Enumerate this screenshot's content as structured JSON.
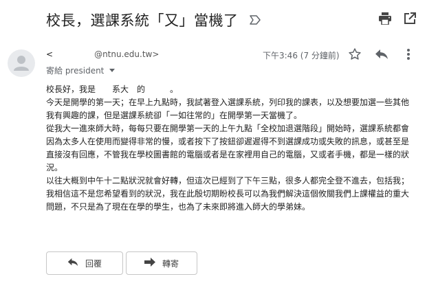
{
  "message": {
    "subject": "校長，選課系統「又」當機了",
    "sender": {
      "name": "<",
      "email": "@ntnu.edu.tw>"
    },
    "recipient_line": "寄給 president",
    "timestamp": "下午3:46 (7 分鐘前)",
    "body": [
      "校長好，我是　　系大　的　　　。",
      "今天是開學的第一天；在早上九點時，我試著登入選課系統，列印我的課表，以及想要加選一些其他我有興趣的課，但是選課系統卻「一如往常的」在開學第一天當機了。",
      "從我大一進來師大時，每每只要在開學第一天的上午九點「全校加退選階段」開始時，選課系統都會因為太多人在使用而變得非常的慢，或者按下了按鈕卻遲遲得不到選課成功或失敗的訊息，或甚至是直接沒有回應，不管我在學校圖書館的電腦或者是在家裡用自己的電腦，又或者手機，都是一樣的狀況。",
      "以往大概到中午十二點狀況就會好轉，但這次已經到了下午三點，很多人都完全登不進去，包括我；我相信這不是您希望看到的狀況，我在此殷切期盼校長可以為我們解決這個攸關我們上課權益的重大問題，不只是為了現在在學的學生，也為了未來即將進入師大的學弟妹。"
    ]
  },
  "actions": {
    "reply_label": "回覆",
    "forward_label": "轉寄"
  },
  "colors": {
    "icon": "#5f6368",
    "text": "#222222",
    "button_border": "#c6c6c6"
  }
}
